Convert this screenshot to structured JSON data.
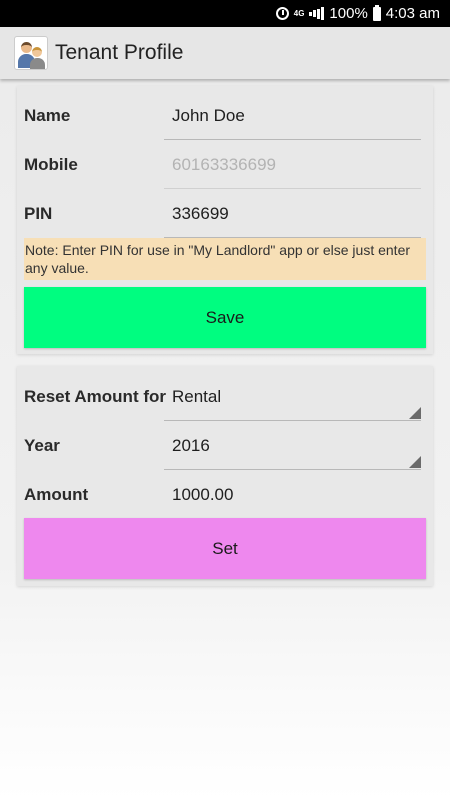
{
  "status_bar": {
    "network": "4G",
    "battery": "100%",
    "time": "4:03 am"
  },
  "app_bar": {
    "title": "Tenant Profile",
    "icon": "tenant-couple-icon"
  },
  "profile": {
    "name_label": "Name",
    "name_value": "John Doe",
    "mobile_label": "Mobile",
    "mobile_placeholder": "60163336699",
    "pin_label": "PIN",
    "pin_value": "336699",
    "note": "Note: Enter PIN for use in \"My Landlord\" app or else just enter any value.",
    "save_label": "Save"
  },
  "reset": {
    "reset_label": "Reset Amount for",
    "reset_value": "Rental",
    "year_label": "Year",
    "year_value": "2016",
    "amount_label": "Amount",
    "amount_value": "1000.00",
    "set_label": "Set"
  },
  "colors": {
    "save_button": "#00fd80",
    "set_button": "#ee88ee",
    "note_background": "#f7dfb6",
    "card_background": "#e8e8e8"
  }
}
